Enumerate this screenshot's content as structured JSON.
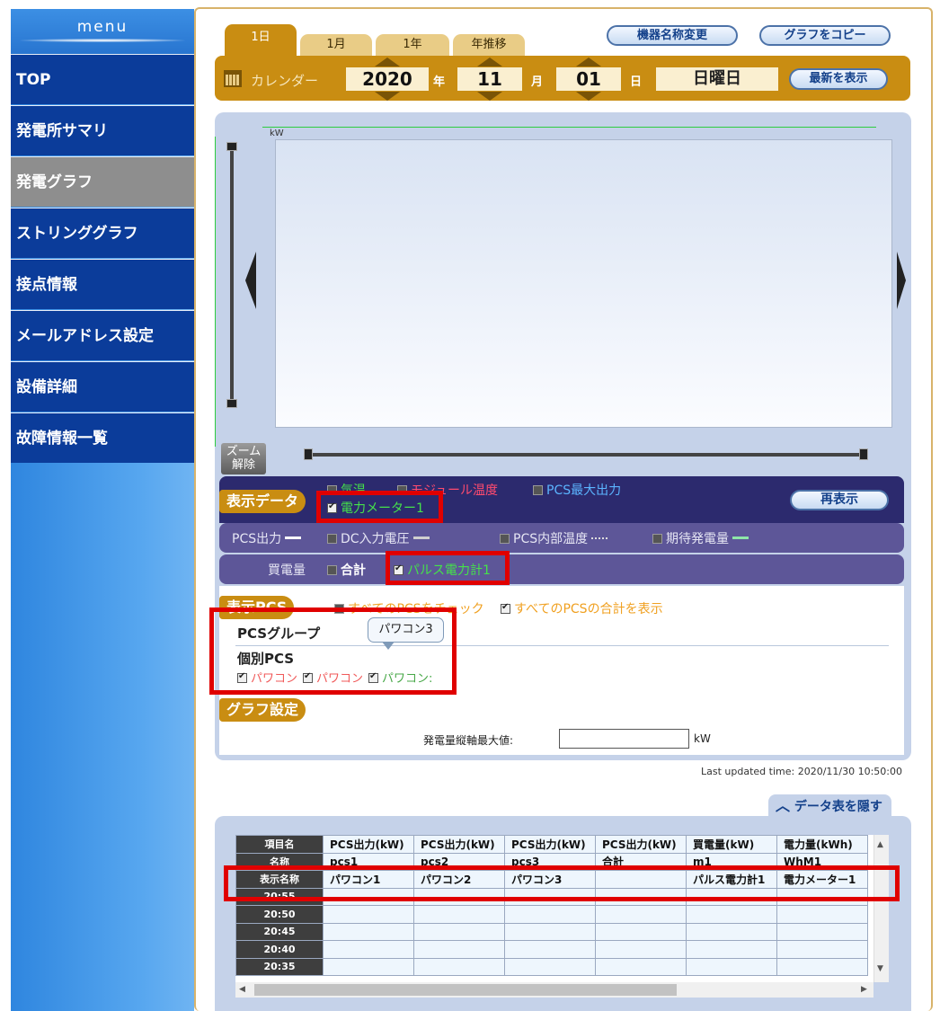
{
  "sidebar": {
    "title": "menu",
    "items": [
      {
        "label": "TOP"
      },
      {
        "label": "発電所サマリ"
      },
      {
        "label": "発電グラフ"
      },
      {
        "label": "ストリンググラフ"
      },
      {
        "label": "接点情報"
      },
      {
        "label": "メールアドレス設定"
      },
      {
        "label": "設備詳細"
      },
      {
        "label": "故障情報一覧"
      }
    ],
    "active_index": 2
  },
  "tabs": [
    {
      "label": "1日"
    },
    {
      "label": "1月"
    },
    {
      "label": "1年"
    },
    {
      "label": "年推移"
    }
  ],
  "header_buttons": {
    "rename": "機器名称変更",
    "copy": "グラフをコピー"
  },
  "calendar": {
    "label": "カレンダー",
    "year": "2020",
    "year_unit": "年",
    "month": "11",
    "month_unit": "月",
    "day": "01",
    "day_unit": "日",
    "weekday": "日曜日",
    "latest_button": "最新を表示"
  },
  "chart": {
    "unit_label": "kW",
    "zoom_reset": "ズーム\n解除"
  },
  "display_data": {
    "title": "表示データ",
    "reshow_button": "再表示",
    "row1": {
      "temp": "気温",
      "module_temp": "モジュール温度",
      "pcs_max": "PCS最大出力",
      "meter1": "電力メーター1"
    },
    "row2": {
      "pcs_output": "PCS出力",
      "dc_voltage": "DC入力電圧",
      "pcs_internal_temp": "PCS内部温度",
      "expected": "期待発電量"
    },
    "row3": {
      "purchase": "買電量",
      "total": "合計",
      "pulse": "パルス電力計1"
    }
  },
  "display_pcs": {
    "title": "表示PCS",
    "check_all": "すべてのPCSをチェック",
    "show_total": "すべてのPCSの合計を表示",
    "group_label": "PCSグループ",
    "individual_label": "個別PCS",
    "tooltip": "パワコン3",
    "pcs_items": [
      "パワコン",
      "パワコン",
      "パワコン:"
    ]
  },
  "graph_settings": {
    "title": "グラフ設定",
    "axis_max_label": "発電量縦軸最大値:",
    "axis_max_value": "",
    "axis_unit": "kW"
  },
  "last_updated": "Last updated time: 2020/11/30 10:50:00",
  "table_toggle": "データ表を隠す",
  "data_table": {
    "header_rows": [
      {
        "label": "項目名",
        "cells": [
          "PCS出力(kW)",
          "PCS出力(kW)",
          "PCS出力(kW)",
          "PCS出力(kW)",
          "買電量(kW)",
          "電力量(kWh)"
        ]
      },
      {
        "label": "名称",
        "cells": [
          "pcs1",
          "pcs2",
          "pcs3",
          "合計",
          "m1",
          "WhM1"
        ]
      },
      {
        "label": "表示名称",
        "cells": [
          "パワコン1",
          "パワコン2",
          "パワコン3",
          "",
          "パルス電力計1",
          "電力メーター1"
        ]
      }
    ],
    "time_rows": [
      "20:55",
      "20:50",
      "20:45",
      "20:40",
      "20:35"
    ]
  },
  "colors": {
    "nav_bg": "#0b3c9a",
    "nav_active": "#8e8e8e",
    "gold": "#c98d12",
    "panel": "#c5d2e9",
    "highlight_red": "#e00000",
    "meter_green": "#45e24a",
    "module_red": "#ff4b6e",
    "pcs_max_blue": "#5bb4ff",
    "pcs_orange": "#f0a020"
  }
}
